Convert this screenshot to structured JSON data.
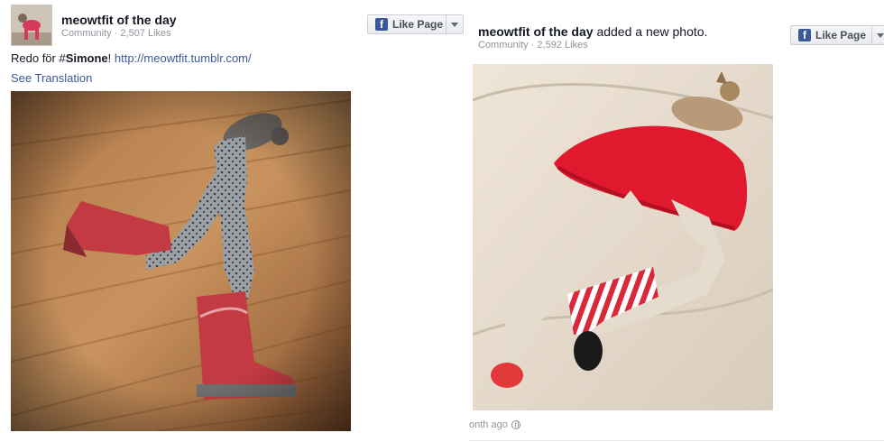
{
  "left_post": {
    "page_name": "meowtfit of the day",
    "page_meta": "Community · 2,507 Likes",
    "like_button": "Like Page",
    "text_prefix": "Redo för #",
    "text_hashtag": "Simone",
    "text_mid": "! ",
    "text_link": "http://meowtfit.tumblr.com/",
    "see_translation": "See Translation"
  },
  "right_post": {
    "page_name": "meowtfit of the day",
    "action": " added a new photo.",
    "page_meta": "Community · 2,592 Likes",
    "like_button": "Like Page",
    "timestamp": "onth ago"
  },
  "icons": [
    "facebook-f-icon",
    "chevron-down-icon",
    "globe-icon"
  ],
  "colors": {
    "link": "#3b5998",
    "fb_blue": "#3b5998",
    "meta_gray": "#90949c"
  }
}
